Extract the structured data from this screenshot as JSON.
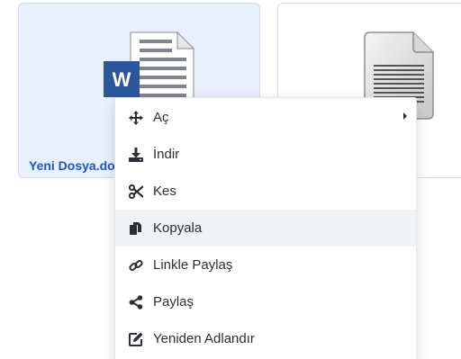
{
  "files": [
    {
      "name": "Yeni Dosya.docx",
      "icon": "word-document-icon",
      "selected": true
    },
    {
      "name": "",
      "icon": "text-document-icon",
      "selected": false
    }
  ],
  "context_menu": {
    "items": [
      {
        "label": "Aç",
        "icon": "move-arrows-icon",
        "has_submenu": true
      },
      {
        "label": "İndir",
        "icon": "download-icon"
      },
      {
        "label": "Kes",
        "icon": "scissors-icon"
      },
      {
        "label": "Kopyala",
        "icon": "copy-icon",
        "hovered": true
      },
      {
        "label": "Linkle Paylaş",
        "icon": "link-icon"
      },
      {
        "label": "Paylaş",
        "icon": "share-icon"
      },
      {
        "label": "Yeniden Adlandır",
        "icon": "edit-icon"
      }
    ]
  },
  "colors": {
    "accent": "#1a58c7",
    "selected_bg": "#e8effd",
    "word_blue": "#2b579a",
    "hover_bg": "#f1f2f5"
  }
}
